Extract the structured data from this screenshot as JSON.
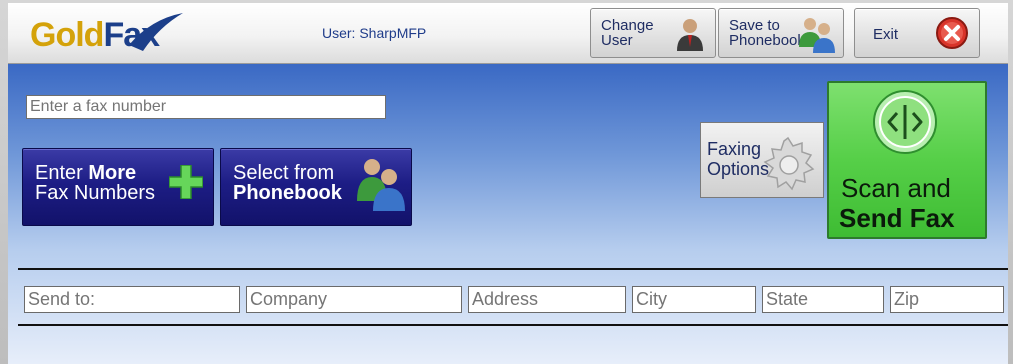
{
  "header": {
    "logo_gold": "Gold",
    "logo_fax": "Fax",
    "user_text": "User: SharpMFP",
    "change_user_label": "Change\nUser",
    "save_phonebook_label": "Save to\nPhonebook",
    "exit_label": "Exit"
  },
  "main": {
    "fax_input_placeholder": "Enter a fax number",
    "enter_more": {
      "line1_a": "Enter ",
      "line1_b": "More",
      "line2": "Fax Numbers"
    },
    "select_phonebook": {
      "line1": "Select from",
      "line2": "Phonebook"
    },
    "faxing_options_label": "Faxing\nOptions",
    "scan_send": {
      "line1": "Scan and",
      "line2": "Send Fax"
    }
  },
  "recipient_columns": [
    "Send to:",
    "Company",
    "Address",
    "City",
    "State",
    "Zip"
  ],
  "icons": {
    "logo_swoosh": "swoosh-icon",
    "change_user": "user-icon",
    "save_phonebook": "phonebook-icon",
    "exit": "close-icon",
    "add": "plus-icon",
    "phonebook": "people-icon",
    "options": "gear-icon",
    "scan": "scan-icon"
  },
  "colors": {
    "brand_gold": "#d4a20a",
    "brand_blue": "#1c3f8a",
    "button_navy": "#1d1d85",
    "scan_green": "#56cf48",
    "exit_red": "#d8342a"
  }
}
